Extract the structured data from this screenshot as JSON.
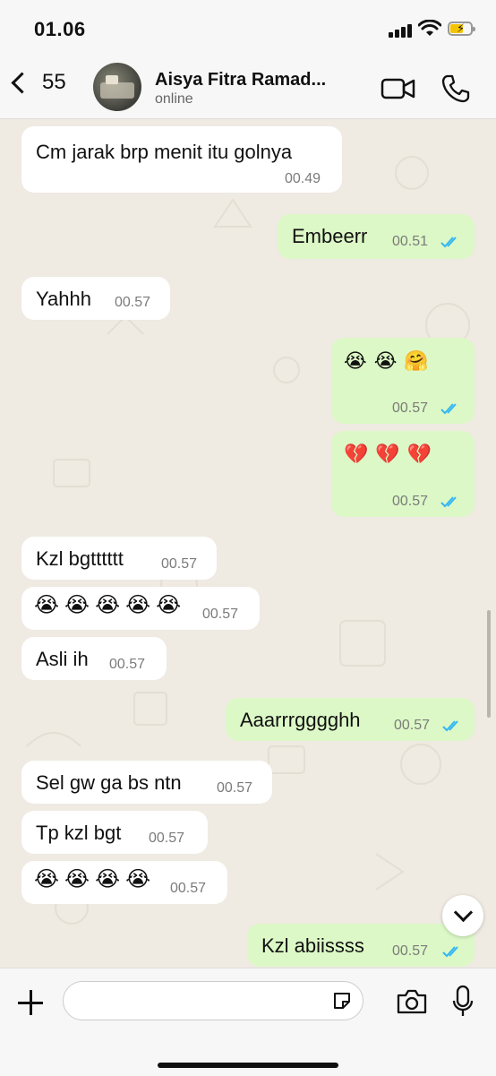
{
  "status_bar": {
    "time": "01.06"
  },
  "header": {
    "back_count": "55",
    "contact_name": "Aisya Fitra Ramad...",
    "contact_status": "online"
  },
  "messages": [
    {
      "dir": "in",
      "text": "Cm jarak brp menit itu golnya",
      "time": "00.49"
    },
    {
      "dir": "out",
      "text": "Embeerr",
      "time": "00.51",
      "read": true
    },
    {
      "dir": "in",
      "text": "Yahhh",
      "time": "00.57"
    },
    {
      "dir": "out",
      "text": "😭😭🤗",
      "time": "00.57",
      "read": true,
      "emoji": true
    },
    {
      "dir": "out",
      "text": "💔💔💔",
      "time": "00.57",
      "read": true,
      "emoji": true
    },
    {
      "dir": "in",
      "text": "Kzl bgtttttt",
      "time": "00.57"
    },
    {
      "dir": "in",
      "text": "😭😭😭😭😭",
      "time": "00.57",
      "emoji": true
    },
    {
      "dir": "in",
      "text": "Asli ih",
      "time": "00.57"
    },
    {
      "dir": "out",
      "text": "Aaarrrgggghh",
      "time": "00.57",
      "read": true
    },
    {
      "dir": "in",
      "text": "Sel gw ga bs ntn",
      "time": "00.57"
    },
    {
      "dir": "in",
      "text": "Tp kzl bgt",
      "time": "00.57"
    },
    {
      "dir": "in",
      "text": "😭😭😭😭",
      "time": "00.57",
      "emoji": true
    },
    {
      "dir": "out",
      "text": "Kzl abiissss",
      "time": "00.57",
      "read": true
    }
  ],
  "composer": {
    "placeholder": ""
  },
  "colors": {
    "incoming_bubble": "#ffffff",
    "outgoing_bubble": "#dcf8c6",
    "read_tick": "#34b7f1",
    "chat_background": "#efeae2"
  },
  "icons": [
    "back-chevron-icon",
    "video-call-icon",
    "phone-icon",
    "scroll-down-icon",
    "plus-icon",
    "sticker-icon",
    "camera-icon",
    "mic-icon"
  ]
}
